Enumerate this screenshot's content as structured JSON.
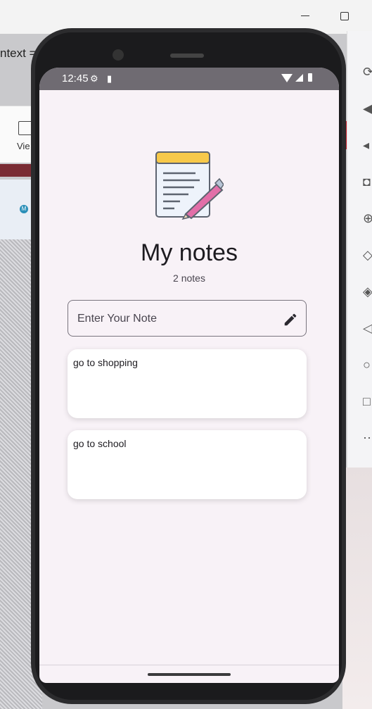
{
  "desktop": {
    "context_text": "ntext =",
    "ribbon_label": "Vie",
    "avatar_letter": "M"
  },
  "status_bar": {
    "time": "12:45"
  },
  "app": {
    "title": "My notes",
    "note_count": "2 notes",
    "input": {
      "placeholder": "Enter Your Note",
      "value": ""
    },
    "notes": [
      {
        "text": "go to shopping"
      },
      {
        "text": "go to school"
      }
    ]
  },
  "colors": {
    "screen_background": "#f8f2f7",
    "card_background": "#ffffff",
    "status_bar": "#6f6b72",
    "logo_yellow": "#f7c94a",
    "logo_pencil": "#e26fa8"
  },
  "icons": {
    "input_action": "pencil-icon",
    "app_logo": "notepad-icon"
  }
}
